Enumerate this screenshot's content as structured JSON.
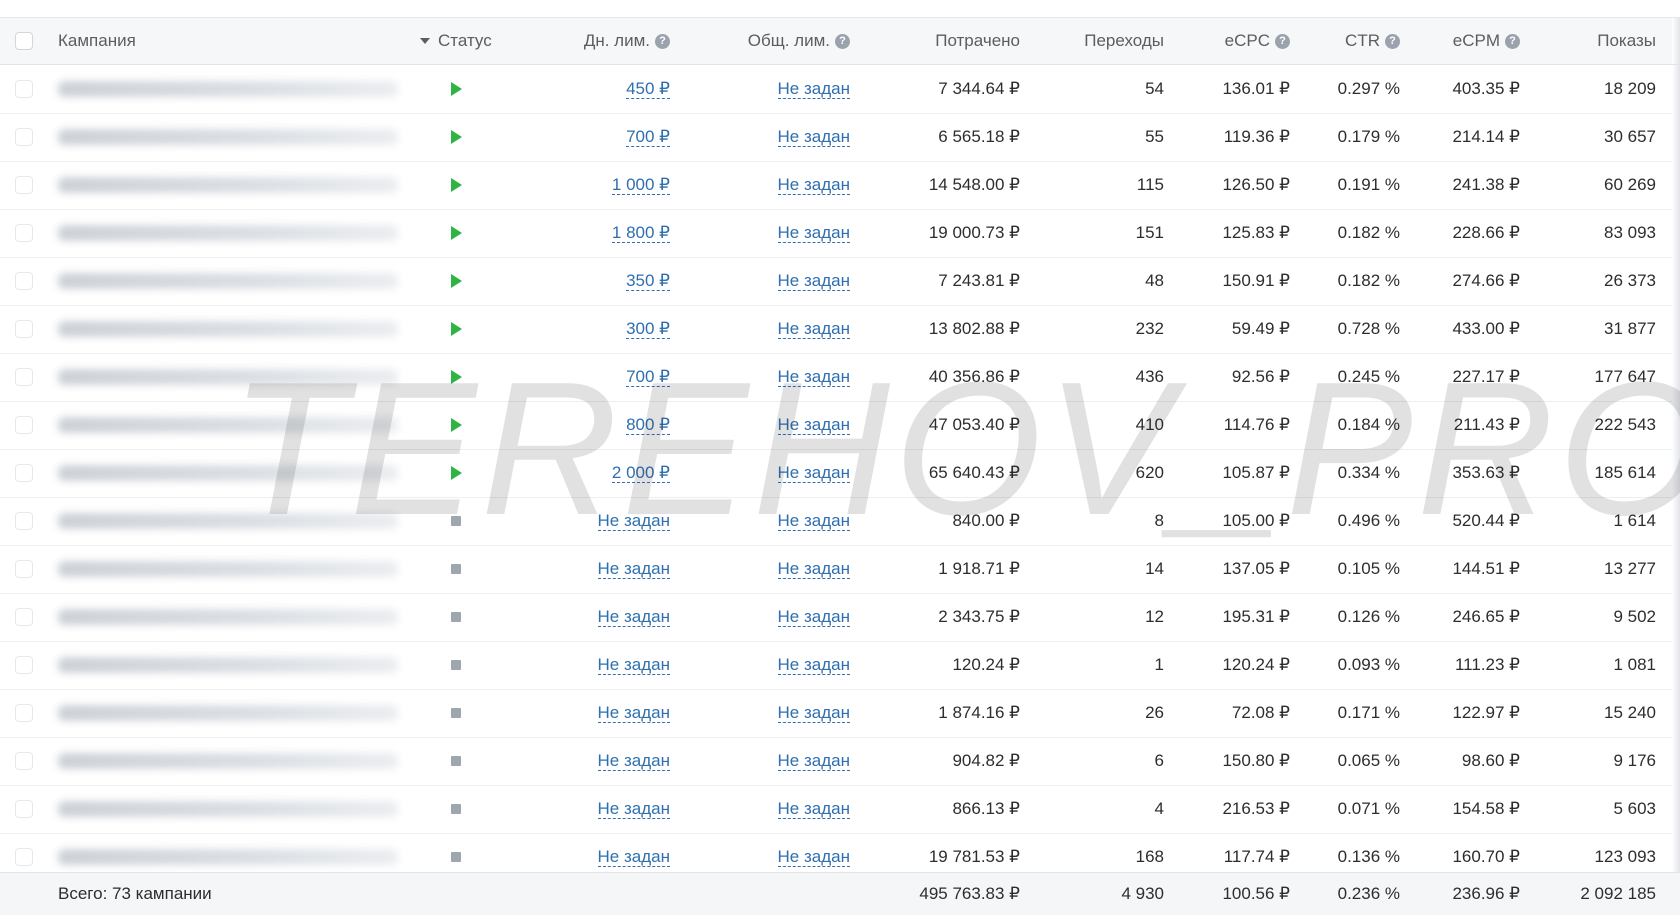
{
  "header": {
    "campaign": "Кампания",
    "status": "Статус",
    "daily_limit": "Дн. лим.",
    "total_limit": "Общ. лим.",
    "spent": "Потрачено",
    "clicks": "Переходы",
    "ecpc": "eCPC",
    "ctr": "CTR",
    "ecpm": "eCPM",
    "impressions": "Показы",
    "help_icon": "?"
  },
  "rows": [
    {
      "status": "active",
      "daily": "450 ₽",
      "total": "Не задан",
      "spent": "7 344.64 ₽",
      "clicks": "54",
      "ecpc": "136.01 ₽",
      "ctr": "0.297 %",
      "ecpm": "403.35 ₽",
      "impr": "18 209"
    },
    {
      "status": "active",
      "daily": "700 ₽",
      "total": "Не задан",
      "spent": "6 565.18 ₽",
      "clicks": "55",
      "ecpc": "119.36 ₽",
      "ctr": "0.179 %",
      "ecpm": "214.14 ₽",
      "impr": "30 657"
    },
    {
      "status": "active",
      "daily": "1 000 ₽",
      "total": "Не задан",
      "spent": "14 548.00 ₽",
      "clicks": "115",
      "ecpc": "126.50 ₽",
      "ctr": "0.191 %",
      "ecpm": "241.38 ₽",
      "impr": "60 269"
    },
    {
      "status": "active",
      "daily": "1 800 ₽",
      "total": "Не задан",
      "spent": "19 000.73 ₽",
      "clicks": "151",
      "ecpc": "125.83 ₽",
      "ctr": "0.182 %",
      "ecpm": "228.66 ₽",
      "impr": "83 093"
    },
    {
      "status": "active",
      "daily": "350 ₽",
      "total": "Не задан",
      "spent": "7 243.81 ₽",
      "clicks": "48",
      "ecpc": "150.91 ₽",
      "ctr": "0.182 %",
      "ecpm": "274.66 ₽",
      "impr": "26 373"
    },
    {
      "status": "active",
      "daily": "300 ₽",
      "total": "Не задан",
      "spent": "13 802.88 ₽",
      "clicks": "232",
      "ecpc": "59.49 ₽",
      "ctr": "0.728 %",
      "ecpm": "433.00 ₽",
      "impr": "31 877"
    },
    {
      "status": "active",
      "daily": "700 ₽",
      "total": "Не задан",
      "spent": "40 356.86 ₽",
      "clicks": "436",
      "ecpc": "92.56 ₽",
      "ctr": "0.245 %",
      "ecpm": "227.17 ₽",
      "impr": "177 647"
    },
    {
      "status": "active",
      "daily": "800 ₽",
      "total": "Не задан",
      "spent": "47 053.40 ₽",
      "clicks": "410",
      "ecpc": "114.76 ₽",
      "ctr": "0.184 %",
      "ecpm": "211.43 ₽",
      "impr": "222 543"
    },
    {
      "status": "active",
      "daily": "2 000 ₽",
      "total": "Не задан",
      "spent": "65 640.43 ₽",
      "clicks": "620",
      "ecpc": "105.87 ₽",
      "ctr": "0.334 %",
      "ecpm": "353.63 ₽",
      "impr": "185 614"
    },
    {
      "status": "stopped",
      "daily": "Не задан",
      "total": "Не задан",
      "spent": "840.00 ₽",
      "clicks": "8",
      "ecpc": "105.00 ₽",
      "ctr": "0.496 %",
      "ecpm": "520.44 ₽",
      "impr": "1 614"
    },
    {
      "status": "stopped",
      "daily": "Не задан",
      "total": "Не задан",
      "spent": "1 918.71 ₽",
      "clicks": "14",
      "ecpc": "137.05 ₽",
      "ctr": "0.105 %",
      "ecpm": "144.51 ₽",
      "impr": "13 277"
    },
    {
      "status": "stopped",
      "daily": "Не задан",
      "total": "Не задан",
      "spent": "2 343.75 ₽",
      "clicks": "12",
      "ecpc": "195.31 ₽",
      "ctr": "0.126 %",
      "ecpm": "246.65 ₽",
      "impr": "9 502"
    },
    {
      "status": "stopped",
      "daily": "Не задан",
      "total": "Не задан",
      "spent": "120.24 ₽",
      "clicks": "1",
      "ecpc": "120.24 ₽",
      "ctr": "0.093 %",
      "ecpm": "111.23 ₽",
      "impr": "1 081"
    },
    {
      "status": "stopped",
      "daily": "Не задан",
      "total": "Не задан",
      "spent": "1 874.16 ₽",
      "clicks": "26",
      "ecpc": "72.08 ₽",
      "ctr": "0.171 %",
      "ecpm": "122.97 ₽",
      "impr": "15 240"
    },
    {
      "status": "stopped",
      "daily": "Не задан",
      "total": "Не задан",
      "spent": "904.82 ₽",
      "clicks": "6",
      "ecpc": "150.80 ₽",
      "ctr": "0.065 %",
      "ecpm": "98.60 ₽",
      "impr": "9 176"
    },
    {
      "status": "stopped",
      "daily": "Не задан",
      "total": "Не задан",
      "spent": "866.13 ₽",
      "clicks": "4",
      "ecpc": "216.53 ₽",
      "ctr": "0.071 %",
      "ecpm": "154.58 ₽",
      "impr": "5 603"
    },
    {
      "status": "stopped",
      "daily": "Не задан",
      "total": "Не задан",
      "spent": "19 781.53 ₽",
      "clicks": "168",
      "ecpc": "117.74 ₽",
      "ctr": "0.136 %",
      "ecpm": "160.70 ₽",
      "impr": "123 093"
    }
  ],
  "totals": {
    "label": "Всего: 73 кампании",
    "spent": "495 763.83 ₽",
    "clicks": "4 930",
    "ecpc": "100.56 ₽",
    "ctr": "0.236 %",
    "ecpm": "236.96 ₽",
    "impr": "2 092 185"
  },
  "watermark": "TEREHOV_PRO",
  "colors": {
    "active": "#2fb344",
    "stopped": "#9ea6b0",
    "link": "#2f6fb0"
  }
}
